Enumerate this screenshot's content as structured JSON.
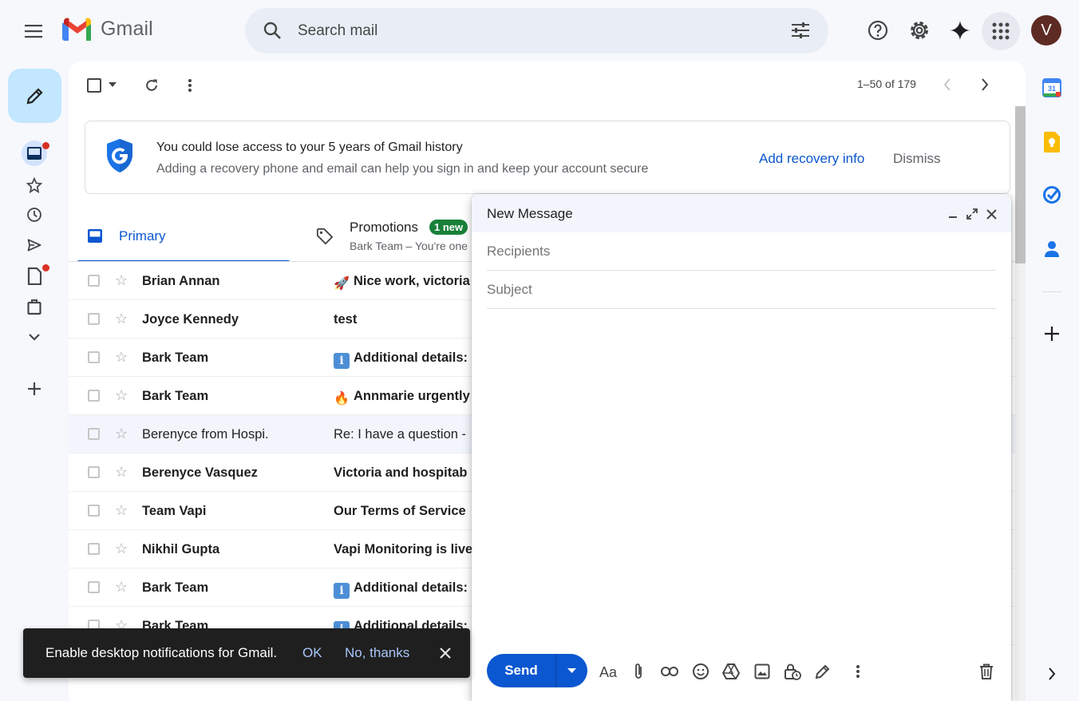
{
  "app": {
    "brand": "Gmail",
    "avatar_letter": "V"
  },
  "search": {
    "placeholder": "Search mail"
  },
  "toolbar": {
    "pager": "1–50 of 179"
  },
  "banner": {
    "title": "You could lose access to your 5 years of Gmail history",
    "subtitle": "Adding a recovery phone and email can help you sign in and keep your account secure",
    "add_label": "Add recovery info",
    "dismiss_label": "Dismiss"
  },
  "tabs": {
    "primary": "Primary",
    "promotions": "Promotions",
    "promotions_badge": "1 new",
    "promotions_preview": "Bark Team – You're one"
  },
  "emails": [
    {
      "sender": "Brian Annan",
      "icon": "rocket",
      "subject": "Nice work, victoria",
      "read": false
    },
    {
      "sender": "Joyce Kennedy",
      "icon": "",
      "subject": "test",
      "read": false
    },
    {
      "sender": "Bark Team",
      "icon": "info",
      "subject": "Additional details:",
      "read": false
    },
    {
      "sender": "Bark Team",
      "icon": "fire",
      "subject": "Annmarie urgently",
      "read": false
    },
    {
      "sender": "Berenyce from Hospi.",
      "icon": "",
      "subject": "Re: I have a question -",
      "read": true
    },
    {
      "sender": "Berenyce Vasquez",
      "icon": "",
      "subject": "Victoria and hospitab",
      "read": false
    },
    {
      "sender": "Team Vapi",
      "icon": "",
      "subject": "Our Terms of Service",
      "read": false
    },
    {
      "sender": "Nikhil Gupta",
      "icon": "",
      "subject": "Vapi Monitoring is live",
      "read": false
    },
    {
      "sender": "Bark Team",
      "icon": "info",
      "subject": "Additional details:",
      "read": false
    },
    {
      "sender": "Bark Team",
      "icon": "info",
      "subject": "Additional details:",
      "read": false
    }
  ],
  "compose": {
    "title": "New Message",
    "recipients_placeholder": "Recipients",
    "subject_placeholder": "Subject",
    "send_label": "Send"
  },
  "toast": {
    "message": "Enable desktop notifications for Gmail.",
    "ok": "OK",
    "no_thanks": "No, thanks"
  },
  "colors": {
    "accent": "#0b57d0",
    "compose_bg": "#c2e7ff",
    "badge": "#188038",
    "unread_dot": "#d93025"
  }
}
